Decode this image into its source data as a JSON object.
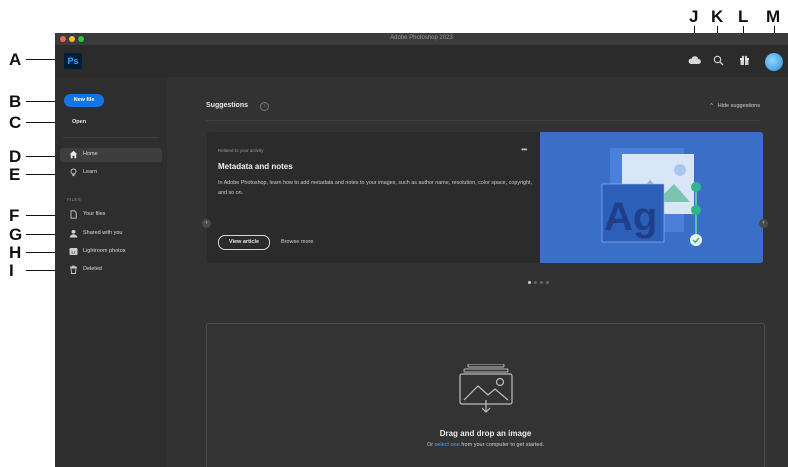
{
  "window": {
    "title": "Adobe Photoshop 2023",
    "traffic_colors": [
      "#ff5f57",
      "#febc2e",
      "#28c840"
    ]
  },
  "appbar": {
    "logo_text": "Ps",
    "icons": [
      "cloud-icon",
      "search-icon",
      "gift-icon",
      "avatar"
    ]
  },
  "sidebar": {
    "new_file_label": "New file",
    "open_label": "Open",
    "nav": [
      {
        "label": "Home",
        "icon": "home-icon",
        "active": true
      },
      {
        "label": "Learn",
        "icon": "lightbulb-icon",
        "active": false
      }
    ],
    "files_heading": "FILES",
    "files": [
      {
        "label": "Your files",
        "icon": "document-icon"
      },
      {
        "label": "Shared with you",
        "icon": "person-icon"
      },
      {
        "label": "Lightroom photos",
        "icon": "lightroom-icon"
      },
      {
        "label": "Deleted",
        "icon": "trash-icon"
      }
    ]
  },
  "main": {
    "suggestions_title": "Suggestions",
    "hide_suggestions_label": "Hide suggestions",
    "card": {
      "small_label": "Related to your activity",
      "title": "Metadata and notes",
      "description": "In Adobe Photoshop, learn how to add metadata and notes to your images, such as author name, resolution, color space, copyright, and so on.",
      "view_button": "View article",
      "browse_label": "Browse more",
      "image_text": "Ag",
      "image_color": "#3a6fc8"
    },
    "carousel_pages": 4,
    "carousel_active": 1,
    "drop": {
      "title": "Drag and drop an image",
      "sub_prefix": "Or ",
      "sub_link": "select one",
      "sub_suffix": " from your computer to get started."
    }
  },
  "callouts": {
    "A": "A",
    "B": "B",
    "C": "C",
    "D": "D",
    "E": "E",
    "F": "F",
    "G": "G",
    "H": "H",
    "I": "I",
    "J": "J",
    "K": "K",
    "L": "L",
    "M": "M"
  }
}
